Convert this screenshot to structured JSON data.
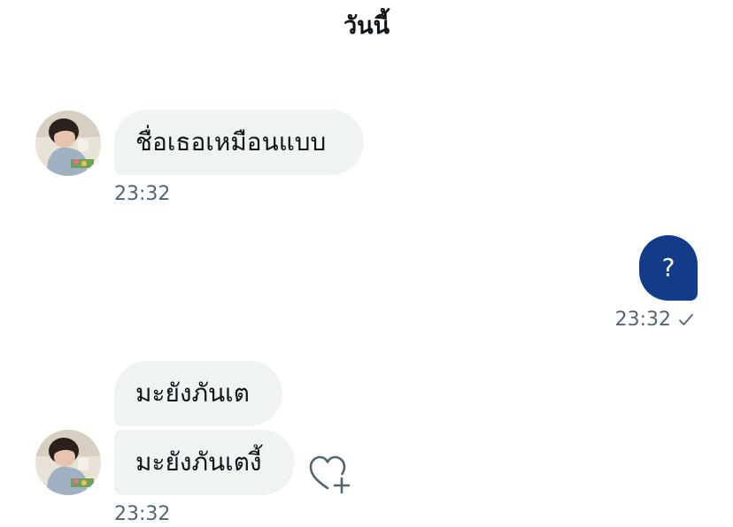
{
  "conversation": {
    "date_header": "วันนี้"
  },
  "messages": [
    {
      "direction": "incoming",
      "text": "ชื่อเธอเหมือนแบบ",
      "time": "23:32"
    },
    {
      "direction": "outgoing",
      "text": "?",
      "time": "23:32",
      "status_icon": "check-icon"
    },
    {
      "direction": "incoming",
      "text": "มะยังภันเต"
    },
    {
      "direction": "incoming",
      "text": "มะยังภันเตงี้",
      "time": "23:32",
      "action_icon": "heart-plus-icon"
    }
  ],
  "colors": {
    "incoming_bubble": "#eff3f4",
    "outgoing_bubble": "#123b8a",
    "timestamp": "#536471",
    "text": "#0f1419"
  }
}
